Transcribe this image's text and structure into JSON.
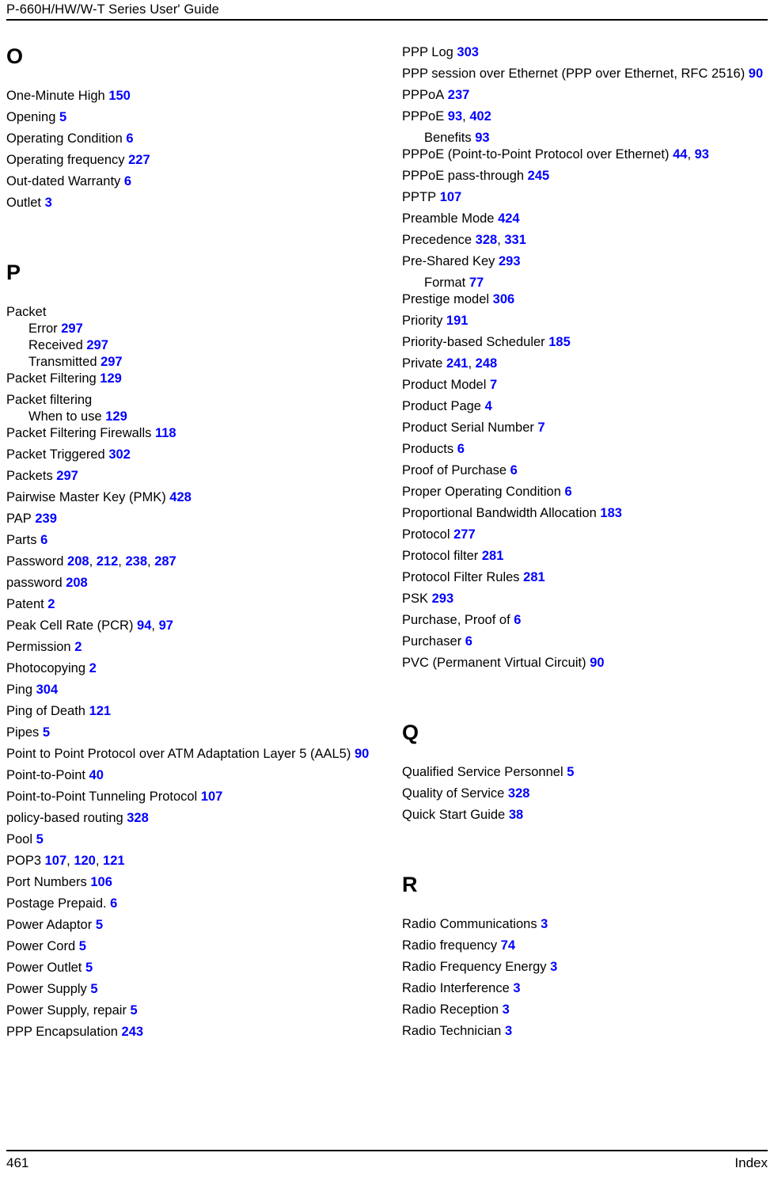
{
  "header": {
    "title": "P-660H/HW/W-T Series User' Guide"
  },
  "footer": {
    "page_number": "461",
    "section_label": "Index"
  },
  "colors": {
    "page_number_link": "#0000FF",
    "text": "#000000",
    "background": "#FFFFFF"
  },
  "columns": [
    {
      "name": "left-column",
      "sections": [
        {
          "letter": "O",
          "entries": [
            {
              "term": "One-Minute High",
              "pages": [
                "150"
              ],
              "level": 0
            },
            {
              "term": "Opening",
              "pages": [
                "5"
              ],
              "level": 0
            },
            {
              "term": "Operating Condition",
              "pages": [
                "6"
              ],
              "level": 0
            },
            {
              "term": "Operating frequency",
              "pages": [
                "227"
              ],
              "level": 0
            },
            {
              "term": "Out-dated Warranty",
              "pages": [
                "6"
              ],
              "level": 0
            },
            {
              "term": "Outlet",
              "pages": [
                "3"
              ],
              "level": 0
            }
          ]
        },
        {
          "letter": "P",
          "entries": [
            {
              "term": "Packet",
              "pages": [],
              "level": 0
            },
            {
              "term": "Error",
              "pages": [
                "297"
              ],
              "level": 1
            },
            {
              "term": "Received",
              "pages": [
                "297"
              ],
              "level": 1
            },
            {
              "term": "Transmitted",
              "pages": [
                "297"
              ],
              "level": 1
            },
            {
              "term": "Packet Filtering",
              "pages": [
                "129"
              ],
              "level": 0
            },
            {
              "term": "Packet filtering",
              "pages": [],
              "level": 0
            },
            {
              "term": "When to use",
              "pages": [
                "129"
              ],
              "level": 1
            },
            {
              "term": "Packet Filtering Firewalls",
              "pages": [
                "118"
              ],
              "level": 0
            },
            {
              "term": "Packet Triggered",
              "pages": [
                "302"
              ],
              "level": 0
            },
            {
              "term": "Packets",
              "pages": [
                "297"
              ],
              "level": 0
            },
            {
              "term": "Pairwise Master Key (PMK)",
              "pages": [
                "428"
              ],
              "level": 0
            },
            {
              "term": "PAP",
              "pages": [
                "239"
              ],
              "level": 0
            },
            {
              "term": "Parts",
              "pages": [
                "6"
              ],
              "level": 0
            },
            {
              "term": "Password",
              "pages": [
                "208",
                "212",
                "238",
                "287"
              ],
              "level": 0
            },
            {
              "term": "password",
              "pages": [
                "208"
              ],
              "level": 0
            },
            {
              "term": "Patent",
              "pages": [
                "2"
              ],
              "level": 0
            },
            {
              "term": "Peak Cell Rate (PCR)",
              "pages": [
                "94",
                "97"
              ],
              "level": 0
            },
            {
              "term": "Permission",
              "pages": [
                "2"
              ],
              "level": 0
            },
            {
              "term": "Photocopying",
              "pages": [
                "2"
              ],
              "level": 0
            },
            {
              "term": "Ping",
              "pages": [
                "304"
              ],
              "level": 0
            },
            {
              "term": "Ping of Death",
              "pages": [
                "121"
              ],
              "level": 0
            },
            {
              "term": "Pipes",
              "pages": [
                "5"
              ],
              "level": 0
            },
            {
              "term": "Point to Point Protocol over ATM Adaptation Layer 5 (AAL5)",
              "pages": [
                "90"
              ],
              "level": 0
            },
            {
              "term": "Point-to-Point",
              "pages": [
                "40"
              ],
              "level": 0
            },
            {
              "term": "Point-to-Point Tunneling Protocol",
              "pages": [
                "107"
              ],
              "level": 0
            },
            {
              "term": "policy-based routing",
              "pages": [
                "328"
              ],
              "level": 0
            },
            {
              "term": "Pool",
              "pages": [
                "5"
              ],
              "level": 0
            },
            {
              "term": "POP3",
              "pages": [
                "107",
                "120",
                "121"
              ],
              "level": 0
            },
            {
              "term": "Port Numbers",
              "pages": [
                "106"
              ],
              "level": 0
            },
            {
              "term": "Postage Prepaid.",
              "pages": [
                "6"
              ],
              "level": 0
            },
            {
              "term": "Power Adaptor",
              "pages": [
                "5"
              ],
              "level": 0
            },
            {
              "term": "Power Cord",
              "pages": [
                "5"
              ],
              "level": 0
            },
            {
              "term": "Power Outlet",
              "pages": [
                "5"
              ],
              "level": 0
            },
            {
              "term": "Power Supply",
              "pages": [
                "5"
              ],
              "level": 0
            },
            {
              "term": "Power Supply, repair",
              "pages": [
                "5"
              ],
              "level": 0
            },
            {
              "term": "PPP Encapsulation",
              "pages": [
                "243"
              ],
              "level": 0
            }
          ]
        }
      ]
    },
    {
      "name": "right-column",
      "sections": [
        {
          "letter": "",
          "entries": [
            {
              "term": "PPP Log",
              "pages": [
                "303"
              ],
              "level": 0
            },
            {
              "term": "PPP session over Ethernet (PPP over Ethernet, RFC 2516)",
              "pages": [
                "90"
              ],
              "level": 0
            },
            {
              "term": "PPPoA",
              "pages": [
                "237"
              ],
              "level": 0
            },
            {
              "term": "PPPoE",
              "pages": [
                "93",
                "402"
              ],
              "level": 0
            },
            {
              "term": "Benefits",
              "pages": [
                "93"
              ],
              "level": 1
            },
            {
              "term": "PPPoE (Point-to-Point Protocol over Ethernet)",
              "pages": [
                "44",
                "93"
              ],
              "level": 0
            },
            {
              "term": "PPPoE pass-through",
              "pages": [
                "245"
              ],
              "level": 0
            },
            {
              "term": "PPTP",
              "pages": [
                "107"
              ],
              "level": 0
            },
            {
              "term": "Preamble Mode",
              "pages": [
                "424"
              ],
              "level": 0
            },
            {
              "term": "Precedence",
              "pages": [
                "328",
                "331"
              ],
              "level": 0
            },
            {
              "term": "Pre-Shared Key",
              "pages": [
                "293"
              ],
              "level": 0
            },
            {
              "term": "Format",
              "pages": [
                "77"
              ],
              "level": 1
            },
            {
              "term": "Prestige model",
              "pages": [
                "306"
              ],
              "level": 0
            },
            {
              "term": "Priority",
              "pages": [
                "191"
              ],
              "level": 0
            },
            {
              "term": "Priority-based Scheduler",
              "pages": [
                "185"
              ],
              "level": 0
            },
            {
              "term": "Private",
              "pages": [
                "241",
                "248"
              ],
              "level": 0
            },
            {
              "term": "Product Model",
              "pages": [
                "7"
              ],
              "level": 0
            },
            {
              "term": "Product Page",
              "pages": [
                "4"
              ],
              "level": 0
            },
            {
              "term": "Product Serial Number",
              "pages": [
                "7"
              ],
              "level": 0
            },
            {
              "term": "Products",
              "pages": [
                "6"
              ],
              "level": 0
            },
            {
              "term": "Proof of Purchase",
              "pages": [
                "6"
              ],
              "level": 0
            },
            {
              "term": "Proper Operating Condition",
              "pages": [
                "6"
              ],
              "level": 0
            },
            {
              "term": "Proportional Bandwidth Allocation",
              "pages": [
                "183"
              ],
              "level": 0
            },
            {
              "term": "Protocol",
              "pages": [
                "277"
              ],
              "level": 0
            },
            {
              "term": "Protocol filter",
              "pages": [
                "281"
              ],
              "level": 0
            },
            {
              "term": "Protocol Filter Rules",
              "pages": [
                "281"
              ],
              "level": 0
            },
            {
              "term": "PSK",
              "pages": [
                "293"
              ],
              "level": 0
            },
            {
              "term": "Purchase, Proof of",
              "pages": [
                "6"
              ],
              "level": 0
            },
            {
              "term": "Purchaser",
              "pages": [
                "6"
              ],
              "level": 0
            },
            {
              "term": "PVC (Permanent Virtual Circuit)",
              "pages": [
                "90"
              ],
              "level": 0
            }
          ]
        },
        {
          "letter": "Q",
          "entries": [
            {
              "term": "Qualified Service Personnel",
              "pages": [
                "5"
              ],
              "level": 0
            },
            {
              "term": "Quality of Service",
              "pages": [
                "328"
              ],
              "level": 0
            },
            {
              "term": "Quick Start Guide",
              "pages": [
                "38"
              ],
              "level": 0
            }
          ]
        },
        {
          "letter": "R",
          "entries": [
            {
              "term": "Radio Communications",
              "pages": [
                "3"
              ],
              "level": 0
            },
            {
              "term": "Radio frequency",
              "pages": [
                "74"
              ],
              "level": 0
            },
            {
              "term": "Radio Frequency Energy",
              "pages": [
                "3"
              ],
              "level": 0
            },
            {
              "term": "Radio Interference",
              "pages": [
                "3"
              ],
              "level": 0
            },
            {
              "term": "Radio Reception",
              "pages": [
                "3"
              ],
              "level": 0
            },
            {
              "term": "Radio Technician",
              "pages": [
                "3"
              ],
              "level": 0
            }
          ]
        }
      ]
    }
  ]
}
